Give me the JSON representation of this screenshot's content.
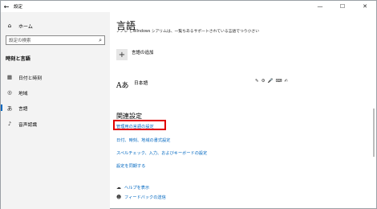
{
  "titlebar": {
    "title": "設定",
    "back_glyph": "←",
    "minimize_glyph": "—",
    "maximize_glyph": "☐",
    "close_glyph": "✕"
  },
  "sidebar": {
    "home": {
      "icon": "home-icon",
      "glyph": "⌂",
      "label": "ホーム"
    },
    "search": {
      "placeholder": "設定の検索",
      "icon": "search-icon",
      "glyph": "⌕"
    },
    "section_title": "時刻と言語",
    "items": [
      {
        "label": "日付と時刻",
        "icon": "calendar-icon",
        "glyph": "▦"
      },
      {
        "label": "地域",
        "icon": "globe-icon",
        "glyph": "◎"
      },
      {
        "label": "言語",
        "icon": "language-icon",
        "glyph": "あ",
        "active": true
      },
      {
        "label": "音声認識",
        "icon": "microphone-icon",
        "glyph": "♪"
      }
    ]
  },
  "main": {
    "title": "言語",
    "description": "ノノレ しWIndows シアリムは、一覧ちあるサポートされている言語でつり小さい",
    "add_language": {
      "plus_glyph": "+",
      "label": "言語の追加"
    },
    "installed_language": {
      "glyph": "Aあ",
      "name": "日本語",
      "features_glyphs": [
        "✎",
        "⚙",
        "🎤",
        "⌨",
        "✍"
      ]
    },
    "related": {
      "title": "関連設定",
      "links": [
        "管理用の言語の設定",
        "日付、時刻、地域の書式設定",
        "スペルチェック、入力、およびキーボードの設定",
        "設定を同期する"
      ]
    },
    "help": [
      {
        "label": "ヘルプを表示",
        "icon": "help-icon",
        "glyph": "☁"
      },
      {
        "label": "フィードバックの送信",
        "icon": "feedback-icon",
        "glyph": "☻"
      }
    ]
  },
  "colors": {
    "accent": "#0067c0",
    "highlight_box": "#e00000",
    "sidebar_bg": "#f3f3f3"
  }
}
